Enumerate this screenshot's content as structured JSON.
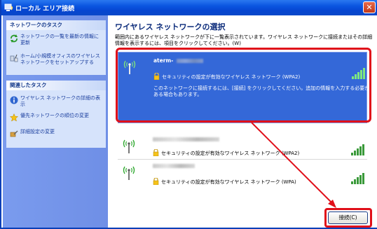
{
  "window": {
    "title": "ローカル エリア接続",
    "close_label": "✕"
  },
  "sidebar": {
    "network_tasks": {
      "header": "ネットワークのタスク",
      "items": [
        {
          "label": "ネットワークの一覧を最新の情報に更新",
          "icon": "refresh-icon"
        },
        {
          "label": "ホーム/小規模オフィスのワイヤレス ネットワークをセットアップする",
          "icon": "setup-wizard-icon"
        }
      ]
    },
    "related_tasks": {
      "header": "関連したタスク",
      "items": [
        {
          "label": "ワイヤレス ネットワークの詳細の表示",
          "icon": "info-icon"
        },
        {
          "label": "優先ネットワークの順位の変更",
          "icon": "star-icon"
        },
        {
          "label": "詳細設定の変更",
          "icon": "settings-icon"
        }
      ]
    }
  },
  "main": {
    "title": "ワイヤレス ネットワークの選択",
    "description": "範囲内にあるワイヤレス ネットワークが下に一覧表示されています。ワイヤレス ネットワークに接続またはその詳細情報を表示するには、項目をクリックしてください。(W)"
  },
  "networks": [
    {
      "ssid": "aterm-",
      "security": "セキュリティの設定が有効なワイヤレス ネットワーク (WPA2)",
      "message": "このネットワークに接続するには、[接続] をクリックしてください。追加の情報を入力する必要がある場合もあります。",
      "signal_bars": 5,
      "selected": true
    },
    {
      "ssid": "",
      "security": "セキュリティの設定が有効なワイヤレス ネットワーク (WPA2)",
      "signal_bars": 5,
      "selected": false
    },
    {
      "ssid": "",
      "security": "セキュリティの設定が有効なワイヤレス ネットワーク (WPA)",
      "signal_bars": 5,
      "selected": false
    }
  ],
  "actions": {
    "connect_label": "接続(C)"
  },
  "colors": {
    "titlebar": "#0a55e0",
    "selection": "#3468d8",
    "highlight": "#e0101a",
    "sidebar": "#7a9bee"
  }
}
